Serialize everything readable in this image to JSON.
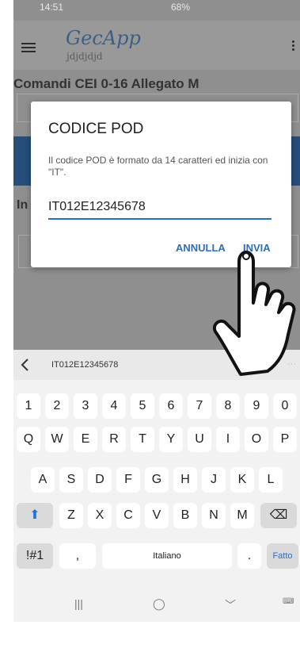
{
  "status_bar": {
    "time": "14:51",
    "right": "68%"
  },
  "app_bar": {
    "title": "GecApp",
    "subtitle": "jdjdjdjd"
  },
  "screen": {
    "section_title": "Comandi CEI 0-16 Allegato M",
    "background_label": "In"
  },
  "dialog": {
    "title": "CODICE POD",
    "message": "Il codice POD è formato da 14 caratteri ed inizia con \"IT\".",
    "input_value": "IT012E12345678",
    "cancel_label": "ANNULLA",
    "send_label": "INVIA"
  },
  "keyboard": {
    "suggestion": "IT012E12345678",
    "row_numbers": [
      "1",
      "2",
      "3",
      "4",
      "5",
      "6",
      "7",
      "8",
      "9",
      "0"
    ],
    "row_top": [
      "Q",
      "W",
      "E",
      "R",
      "T",
      "Y",
      "U",
      "I",
      "O",
      "P"
    ],
    "row_middle": [
      "A",
      "S",
      "D",
      "F",
      "G",
      "H",
      "J",
      "K",
      "L"
    ],
    "row_bottom": [
      "Z",
      "X",
      "C",
      "V",
      "B",
      "N",
      "M"
    ],
    "symbols_label": "!#1",
    "comma_label": ",",
    "space_label": "Italiano",
    "period_label": ".",
    "done_label": "Fatto"
  },
  "colors": {
    "accent": "#2f6db6",
    "header_bar": "#264e7a",
    "title": "#3f5f82"
  }
}
